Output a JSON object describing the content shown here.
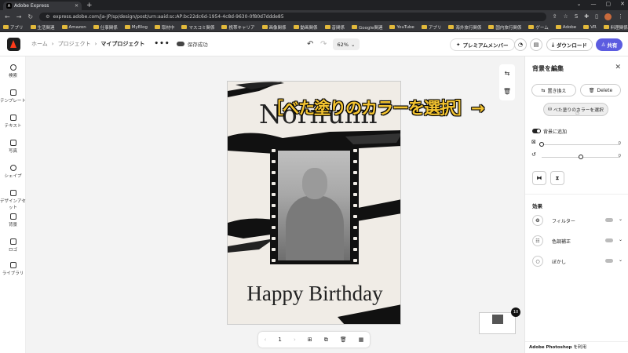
{
  "browser": {
    "tab_title": "Adobe Express",
    "url": "express.adobe.com/ja-JP/sp/design/post/urn:aaid:sc:AP:bc22dc6d-1954-4c8d-9630-0f80d7ddde85",
    "bookmarks": [
      "アプリ",
      "生活関連",
      "Amazon",
      "仕事関係",
      "MyBlog",
      "取材中",
      "マスコミ関係",
      "携帯キャリア",
      "画像関係",
      "動画関係",
      "音関係",
      "Google関連",
      "YouTube",
      "アプリ",
      "海外旅行関係",
      "国内旅行関係",
      "ゲーム",
      "Adobe",
      "VR",
      "料理関係",
      "AI"
    ]
  },
  "header": {
    "crumb_home": "ホーム",
    "crumb_project": "プロジェクト",
    "crumb_current": "マイプロジェクト",
    "more": "•••",
    "save_status": "保存成功",
    "undo": "↶",
    "redo": "↷",
    "zoom": "62%",
    "premium": "プレミアムメンバー",
    "download": "ダウンロード",
    "share": "共有"
  },
  "leftbar": [
    "検索",
    "テンプレート",
    "テキスト",
    "写真",
    "シェイプ",
    "デザインアセット",
    "背景",
    "ロゴ",
    "ライブラリ"
  ],
  "canvas": {
    "name_text": "Norifumi",
    "birthday_text": "Happy Birthday",
    "page_number": "1",
    "thumb_count": "10"
  },
  "right_panel": {
    "title": "背景を編集",
    "replace": "置き換え",
    "delete": "Delete",
    "fill_color": "べた塗りのカラーを選択",
    "add_to_bg": "背景に追加",
    "slider1_value": "0",
    "slider2_value": "0",
    "slider1_fraction": 0.0,
    "slider2_fraction": 0.5,
    "effects_title": "効果",
    "effects": [
      "フィルター",
      "色調補正",
      "ぼかし"
    ],
    "photoshop_label": "Adobe Photoshop",
    "photoshop_suffix": "を利用"
  },
  "overlay": {
    "annotation": "［べた塗りのカラーを選択］→"
  },
  "colors": {
    "accent": "#5c5ce0",
    "annotation": "#f4c430",
    "logo_red": "#ff3b1a"
  }
}
